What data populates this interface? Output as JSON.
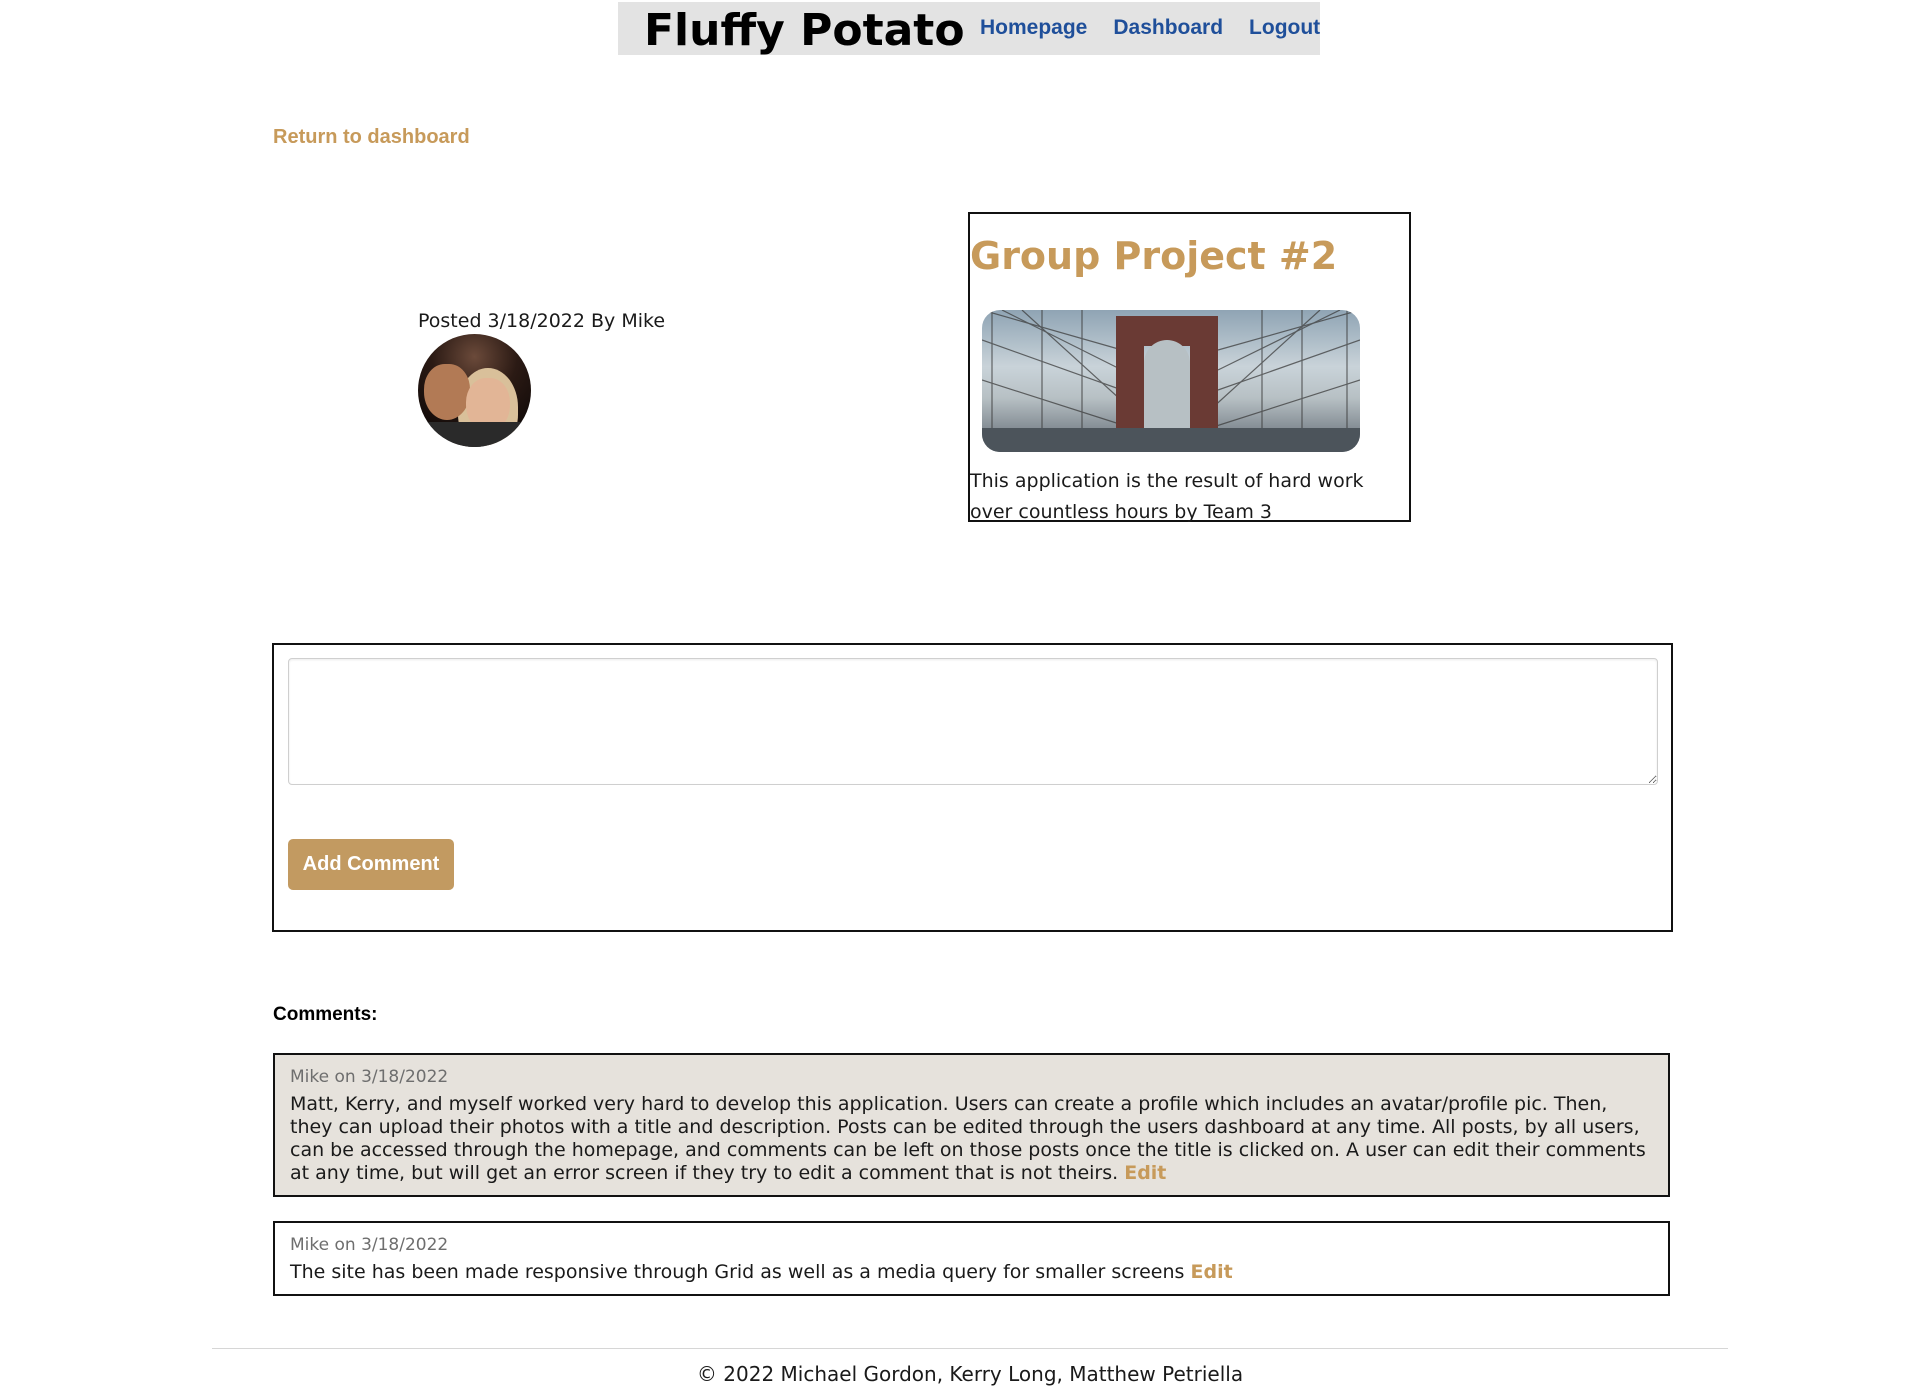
{
  "header": {
    "site_title": "Fluffy Potato",
    "nav": [
      {
        "label": "Homepage"
      },
      {
        "label": "Dashboard"
      },
      {
        "label": "Logout"
      }
    ]
  },
  "return_link": "Return to dashboard",
  "post": {
    "meta": "Posted 3/18/2022 By Mike",
    "title": "Group Project #2",
    "description": "This application is the result of hard work over countless hours by Team 3"
  },
  "comment_form": {
    "textarea_value": "",
    "button_label": "Add Comment"
  },
  "comments_heading": "Comments:",
  "comments": [
    {
      "meta": "Mike on 3/18/2022",
      "text": "Matt, Kerry, and myself worked very hard to develop this application. Users can create a profile which includes an avatar/profile pic. Then, they can upload their photos with a title and description. Posts can be edited through the users dashboard at any time. All posts, by all users, can be accessed through the homepage, and comments can be left on those posts once the title is clicked on. A user can edit their comments at any time, but will get an error screen if they try to edit a comment that is not theirs.",
      "edit_label": "Edit"
    },
    {
      "meta": "Mike on 3/18/2022",
      "text": "The site has been made responsive through Grid as well as a media query for smaller screens",
      "edit_label": "Edit"
    }
  ],
  "footer": "© 2022 Michael Gordon, Kerry Long, Matthew Petriella",
  "colors": {
    "accent_gold": "#c79a5a",
    "nav_blue": "#1f4f9a",
    "header_bg": "#e3e3e3",
    "comment_shaded_bg": "#e6e2dc"
  }
}
